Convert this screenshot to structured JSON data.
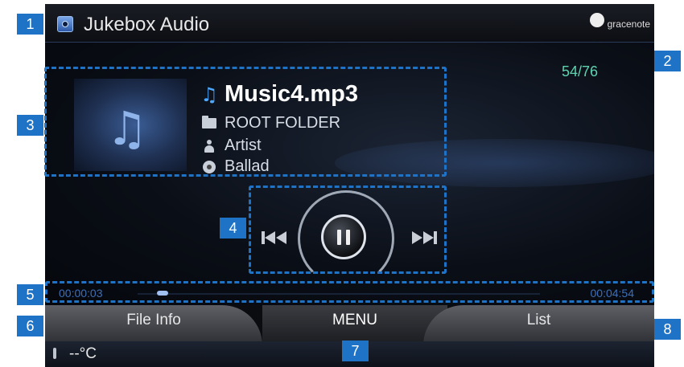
{
  "header": {
    "app_title": "Jukebox Audio",
    "brand": "gracenote"
  },
  "player": {
    "track_counter": "54/76",
    "title": "Music4.mp3",
    "folder": "ROOT FOLDER",
    "artist": "Artist",
    "genre": "Ballad",
    "elapsed": "00:00:03",
    "duration": "00:04:54",
    "progress_fraction": 0.01
  },
  "tabs": {
    "file_info": "File Info",
    "menu": "MENU",
    "list": "List"
  },
  "status": {
    "temperature": "--°C"
  },
  "callouts": [
    "1",
    "2",
    "3",
    "4",
    "5",
    "6",
    "7",
    "8"
  ],
  "colors": {
    "accent": "#1f73c6",
    "counter": "#5fd3b0",
    "time": "#3d6fb8"
  }
}
